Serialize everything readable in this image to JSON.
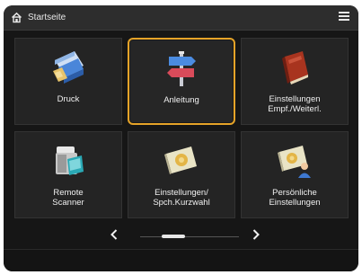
{
  "header": {
    "title": "Startseite"
  },
  "tiles": [
    {
      "label": "Druck"
    },
    {
      "label": "Anleitung"
    },
    {
      "label": "Einstellungen\nEmpf./Weiterl."
    },
    {
      "label": "Remote\nScanner"
    },
    {
      "label": "Einstellungen/\nSpch.Kurzwahl"
    },
    {
      "label": "Persönliche\nEinstellungen"
    }
  ],
  "selected_tile": "Anleitung",
  "colors": {
    "accent": "#e5a328",
    "background": "#161616",
    "tile": "#242424"
  },
  "pager": {
    "current_page": 2,
    "total_pages": 3
  }
}
